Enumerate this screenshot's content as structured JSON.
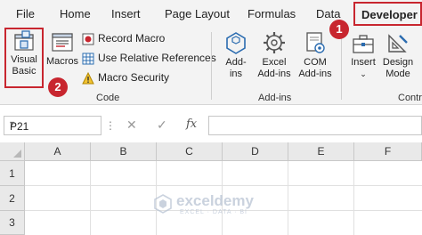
{
  "tabs": [
    "File",
    "Home",
    "Insert",
    "Page Layout",
    "Formulas",
    "Data",
    "Developer"
  ],
  "active_tab": "Developer",
  "ribbon": {
    "code_group": {
      "label": "Code",
      "visual_basic": [
        "Visual",
        "Basic"
      ],
      "macros": "Macros",
      "record_macro": "Record Macro",
      "relative_refs": "Use Relative References",
      "macro_security": "Macro Security"
    },
    "addins_group": {
      "label": "Add-ins",
      "addins": [
        "Add-",
        "ins"
      ],
      "excel_addins": [
        "Excel",
        "Add-ins"
      ],
      "com_addins": [
        "COM",
        "Add-ins"
      ]
    },
    "controls_group": {
      "label": "Contr",
      "insert": "Insert",
      "design_mode": [
        "Design",
        "Mode"
      ]
    }
  },
  "badges": [
    "1",
    "2"
  ],
  "formula_bar": {
    "name_box": "P21",
    "cancel_symbol": "✕",
    "enter_symbol": "✓",
    "fx_symbol": "fx",
    "formula_value": ""
  },
  "sheet": {
    "columns": [
      "A",
      "B",
      "C",
      "D",
      "E",
      "F"
    ],
    "rows": [
      "1",
      "2",
      "3"
    ]
  },
  "watermark": {
    "name": "exceldemy",
    "tagline": "EXCEL · DATA · BI"
  },
  "colors": {
    "highlight": "#c8262f",
    "accent_blue": "#2b6cb0",
    "ribbon_bg": "#f3f3f3"
  }
}
